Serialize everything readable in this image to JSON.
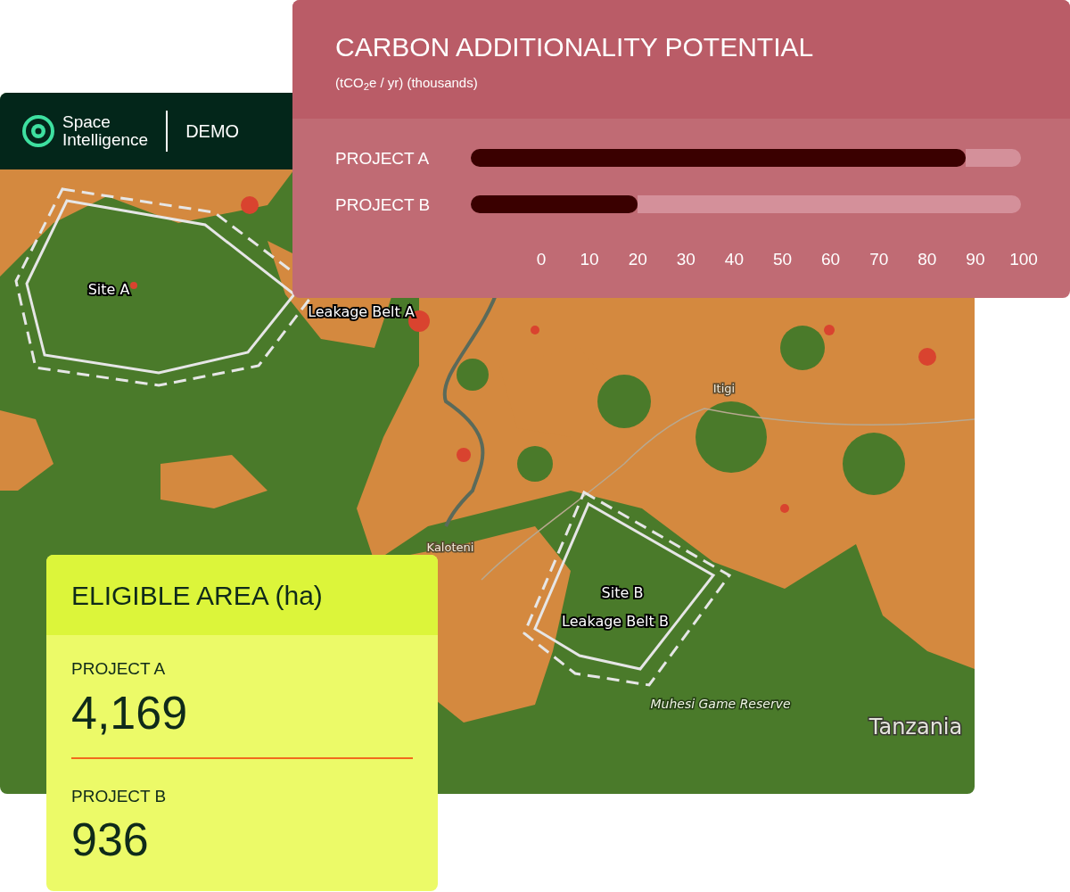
{
  "app_header": {
    "brand_line_1": "Space",
    "brand_line_2": "Intelligence",
    "mode": "DEMO"
  },
  "map": {
    "labels": [
      {
        "text": "Site A",
        "kind": "site"
      },
      {
        "text": "Leakage Belt A",
        "kind": "site"
      },
      {
        "text": "Itigi",
        "kind": "place"
      },
      {
        "text": "Kaloteni",
        "kind": "place"
      },
      {
        "text": "Site B",
        "kind": "site"
      },
      {
        "text": "Leakage Belt B",
        "kind": "site"
      },
      {
        "text": "Muhesi Game Reserve",
        "kind": "reserve"
      },
      {
        "text": "Tanzania",
        "kind": "country"
      }
    ]
  },
  "carbon_card": {
    "title": "CARBON ADDITIONALITY POTENTIAL",
    "subtitle": "(tCO$_{2}$e / yr) (thousands)",
    "chart_data": {
      "type": "bar",
      "orientation": "horizontal",
      "categories": [
        "PROJECT A",
        "PROJECT B"
      ],
      "values": [
        88,
        20
      ],
      "xlim": [
        0,
        100
      ],
      "xticks": [
        0,
        10,
        20,
        30,
        40,
        50,
        60,
        70,
        80,
        90,
        100
      ]
    }
  },
  "area_card": {
    "title": "ELIGIBLE AREA (ha)",
    "items": [
      {
        "label": "PROJECT A",
        "value": "4,169"
      },
      {
        "label": "PROJECT B",
        "value": "936"
      }
    ]
  }
}
